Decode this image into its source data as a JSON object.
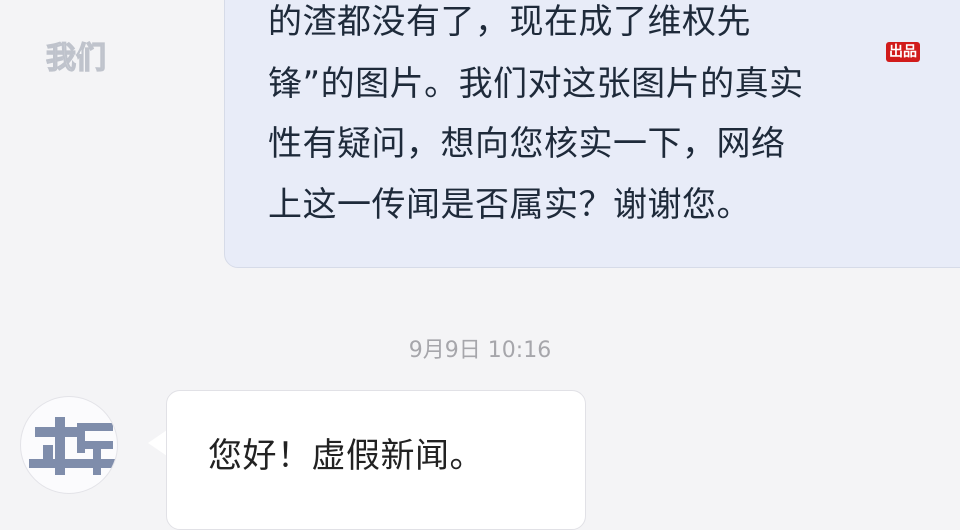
{
  "watermark": {
    "logo_text": "我们",
    "tag": "出品"
  },
  "conversation": {
    "outgoing_message": {
      "lines": [
        "的渣都没有了，现在成了维权先",
        "锋”的图片。我们对这张图片的真实",
        "性有疑问，想向您核实一下，网络",
        "上这一传闻是否属实？谢谢您。"
      ]
    },
    "timestamp": "9月9日 10:16",
    "incoming_message": {
      "text": "您好！虚假新闻。"
    }
  },
  "colors": {
    "outgoing_bubble": "#e8ecf8",
    "incoming_bubble": "#ffffff",
    "background": "#f4f4f6",
    "badge": "#d11b1b"
  }
}
